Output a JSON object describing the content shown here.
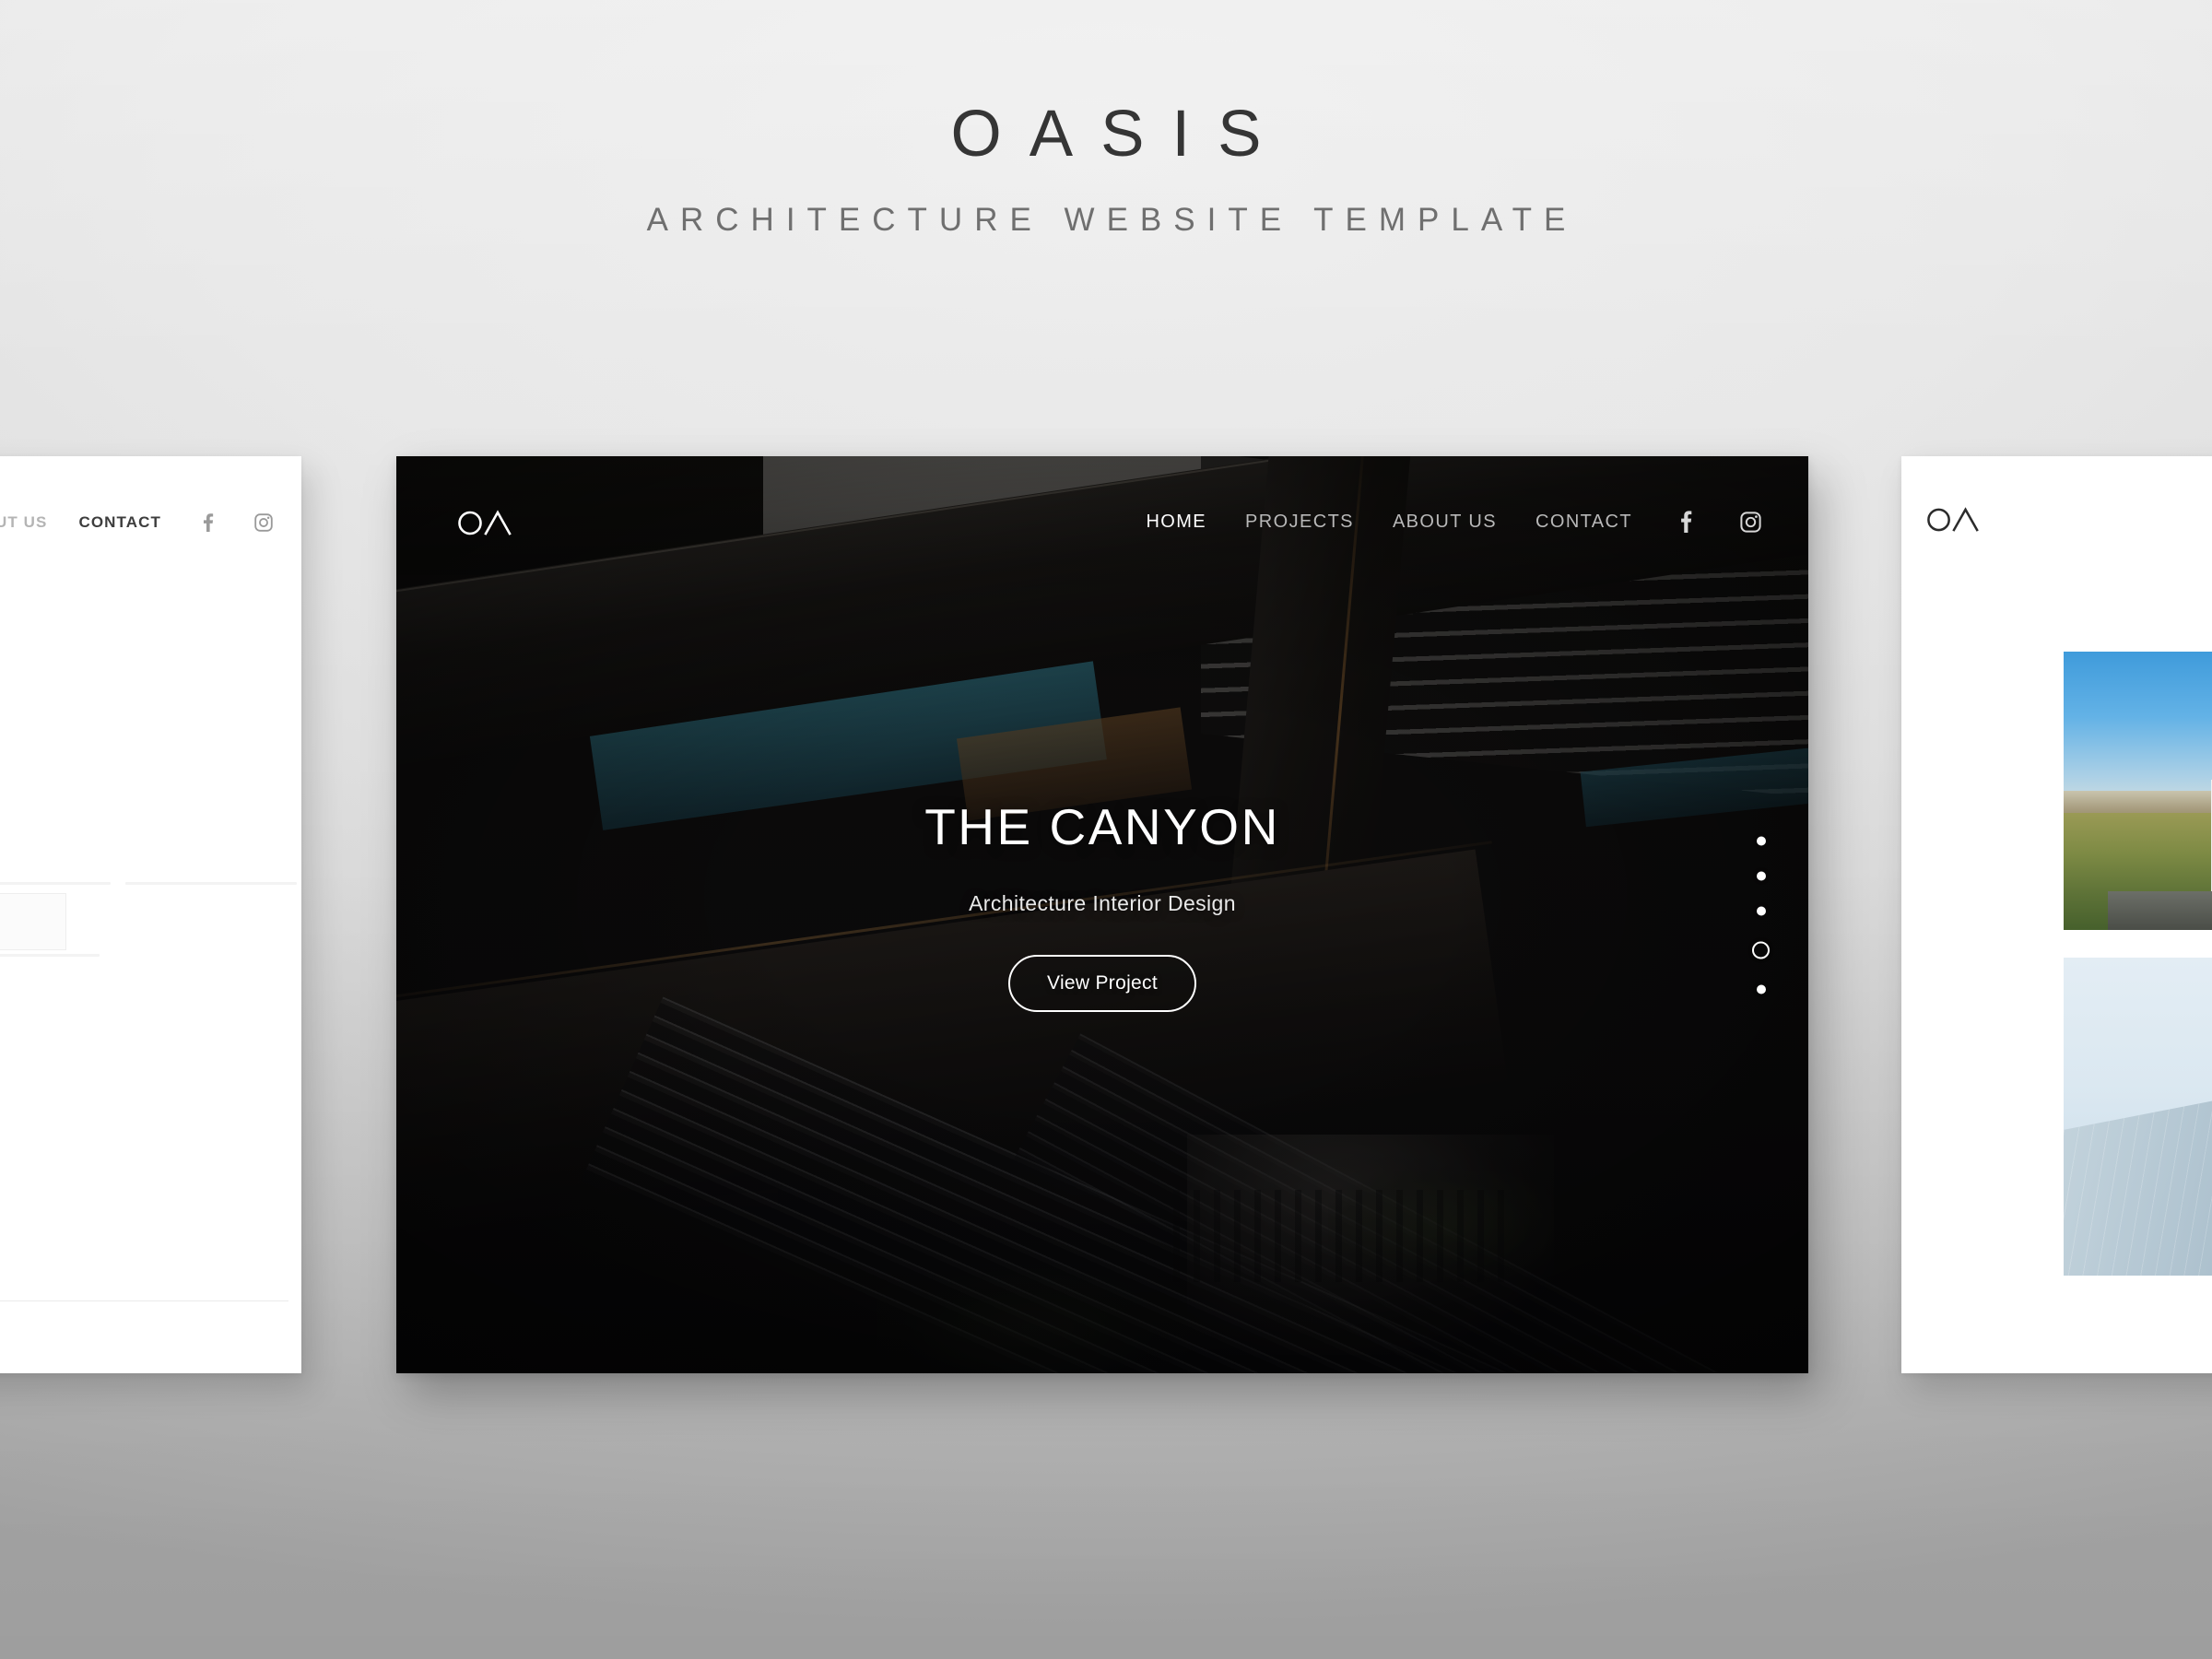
{
  "masthead": {
    "title": "OASIS",
    "subtitle": "ARCHITECTURE WEBSITE TEMPLATE"
  },
  "colors": {
    "page_background_top": "#ececec",
    "page_background_bottom": "#adadad",
    "title_text": "#353535",
    "subtitle_text": "#6f6f6f",
    "nav_active": "#ffffff",
    "nav_inactive": "#b8b8b8",
    "hero_text": "#ffffff",
    "left_window_background": "#ffffff",
    "right_window_background": "#ffffff"
  },
  "main_window": {
    "logo": "OA",
    "logo_icon": "oasis-logo-icon",
    "nav": [
      {
        "label": "HOME",
        "active": true
      },
      {
        "label": "PROJECTS",
        "active": false
      },
      {
        "label": "ABOUT US",
        "active": false
      },
      {
        "label": "CONTACT",
        "active": false
      }
    ],
    "social": [
      {
        "name": "facebook-icon",
        "label": "Facebook"
      },
      {
        "name": "instagram-icon",
        "label": "Instagram"
      }
    ],
    "hero": {
      "title": "THE CANYON",
      "subtitle": "Architecture Interior Design",
      "cta_label": "View Project",
      "background_description": "Dark mall interior with crossing escalators"
    },
    "slider": {
      "total_slides": 5,
      "active_slide": 4,
      "dots": [
        {
          "active": false
        },
        {
          "active": false
        },
        {
          "active": false
        },
        {
          "active": true
        },
        {
          "active": false
        }
      ]
    }
  },
  "left_window": {
    "nav": [
      {
        "label": "ABOUT US",
        "active": false
      },
      {
        "label": "CONTACT",
        "active": true
      }
    ],
    "social": [
      {
        "name": "facebook-icon",
        "label": "Facebook"
      },
      {
        "name": "instagram-icon",
        "label": "Instagram"
      }
    ]
  },
  "right_window": {
    "logo": "OA",
    "logo_icon": "oasis-logo-icon",
    "thumbnails": [
      {
        "name": "project-thumbnail-building-exterior",
        "description": "White modern building with blue sky and autumn trees"
      },
      {
        "name": "project-thumbnail-metallic-facade",
        "description": "Angular pale blue metallic facade against sky"
      }
    ]
  }
}
